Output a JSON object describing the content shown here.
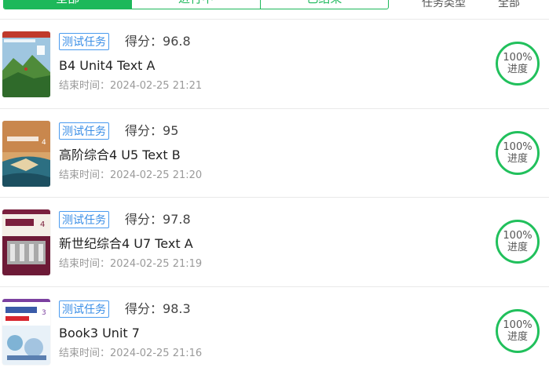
{
  "tabs": [
    {
      "label": "全部",
      "active": true
    },
    {
      "label": "进行中",
      "active": false
    },
    {
      "label": "已结束",
      "active": false
    }
  ],
  "filters": {
    "task_type": "任务类型",
    "scope": "全部"
  },
  "colors": {
    "accent": "#1db85a",
    "badge": "#3a8ee6",
    "muted": "#9a9a9a"
  },
  "items": [
    {
      "badge": "测试任务",
      "score_label": "得分：",
      "score": "96.8",
      "title": "B4 Unit4 Text A",
      "time_label": "结束时间：",
      "time": "2024-02-25 21:21",
      "progress": "100%",
      "progress_label": "进度",
      "cover": "mountain-cover"
    },
    {
      "badge": "测试任务",
      "score_label": "得分：",
      "score": "95",
      "title": "高阶综合4 U5 Text B",
      "time_label": "结束时间：",
      "time": "2024-02-25 21:20",
      "progress": "100%",
      "progress_label": "进度",
      "cover": "coast-cover"
    },
    {
      "badge": "测试任务",
      "score_label": "得分：",
      "score": "97.8",
      "title": "新世纪综合4 U7 Text A",
      "time_label": "结束时间：",
      "time": "2024-02-25 21:19",
      "progress": "100%",
      "progress_label": "进度",
      "cover": "building-cover"
    },
    {
      "badge": "测试任务",
      "score_label": "得分：",
      "score": "98.3",
      "title": "Book3 Unit 7",
      "time_label": "结束时间：",
      "time": "2024-02-25 21:16",
      "progress": "100%",
      "progress_label": "进度",
      "cover": "abstract-cover"
    }
  ]
}
